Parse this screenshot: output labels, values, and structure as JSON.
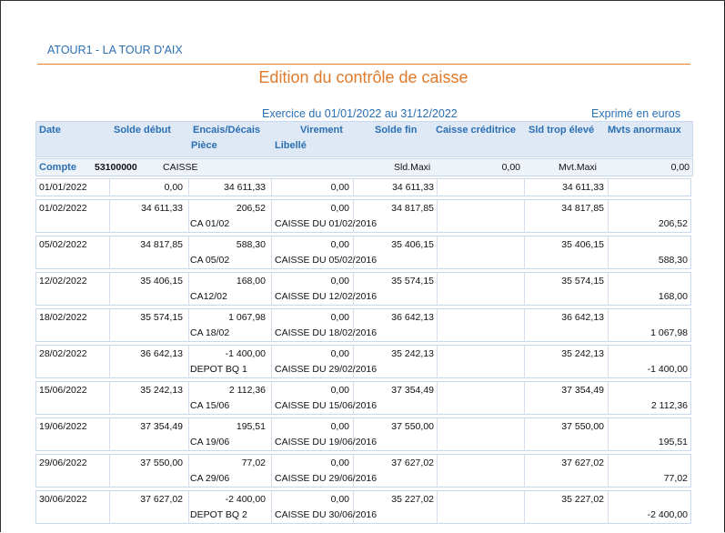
{
  "header": {
    "company": "ATOUR1 - LA TOUR D'AIX",
    "title": "Edition du contrôle de caisse",
    "period": "Exercice du 01/01/2022 au 31/12/2022",
    "unit": "Exprimé en euros"
  },
  "columns": {
    "date": "Date",
    "solde_debut": "Solde début",
    "encais_decais": "Encais/Décais",
    "piece": "Pièce",
    "virement": "Virement",
    "libelle": "Libellé",
    "solde_fin": "Solde fin",
    "caisse_creditrice": "Caisse créditrice",
    "sld_trop_eleve": "Sld trop élevé",
    "mvts_anormaux": "Mvts anormaux"
  },
  "account": {
    "label": "Compte",
    "number": "53100000",
    "name": "CAISSE",
    "sld_maxi_label": "Sld.Maxi",
    "sld_maxi_value": "0,00",
    "mvt_maxi_label": "Mvt.Maxi",
    "mvt_maxi_value": "0,00"
  },
  "rows": [
    {
      "date": "01/01/2022",
      "solde_debut": "0,00",
      "encais": "34 611,33",
      "virement": "0,00",
      "solde_fin": "34 611,33",
      "sld_trop": "34 611,33",
      "piece": "",
      "libelle": "",
      "mvts": ""
    },
    {
      "date": "01/02/2022",
      "solde_debut": "34 611,33",
      "encais": "206,52",
      "virement": "0,00",
      "solde_fin": "34 817,85",
      "sld_trop": "34 817,85",
      "piece": "CA 01/02",
      "libelle": "CAISSE DU 01/02/2016",
      "mvts": "206,52"
    },
    {
      "date": "05/02/2022",
      "solde_debut": "34 817,85",
      "encais": "588,30",
      "virement": "0,00",
      "solde_fin": "35 406,15",
      "sld_trop": "35 406,15",
      "piece": "CA 05/02",
      "libelle": "CAISSE DU  05/02/2016",
      "mvts": "588,30"
    },
    {
      "date": "12/02/2022",
      "solde_debut": "35 406,15",
      "encais": "168,00",
      "virement": "0,00",
      "solde_fin": "35 574,15",
      "sld_trop": "35 574,15",
      "piece": "CA12/02",
      "libelle": "CAISSE DU  12/02/2016",
      "mvts": "168,00"
    },
    {
      "date": "18/02/2022",
      "solde_debut": "35 574,15",
      "encais": "1 067,98",
      "virement": "0,00",
      "solde_fin": "36 642,13",
      "sld_trop": "36 642,13",
      "piece": "CA 18/02",
      "libelle": "CAISSE DU  18/02/2016",
      "mvts": "1 067,98"
    },
    {
      "date": "28/02/2022",
      "solde_debut": "36 642,13",
      "encais": "-1 400,00",
      "virement": "0,00",
      "solde_fin": "35 242,13",
      "sld_trop": "35 242,13",
      "piece": "DEPOT BQ 1",
      "libelle": "CAISSE DU  29/02/2016",
      "mvts": "-1 400,00"
    },
    {
      "date": "15/06/2022",
      "solde_debut": "35 242,13",
      "encais": "2 112,36",
      "virement": "0,00",
      "solde_fin": "37 354,49",
      "sld_trop": "37 354,49",
      "piece": "CA 15/06",
      "libelle": "CAISSE DU  15/06/2016",
      "mvts": "2 112,36"
    },
    {
      "date": "19/06/2022",
      "solde_debut": "37 354,49",
      "encais": "195,51",
      "virement": "0,00",
      "solde_fin": "37 550,00",
      "sld_trop": "37 550,00",
      "piece": "CA 19/06",
      "libelle": "CAISSE DU  19/06/2016",
      "mvts": "195,51"
    },
    {
      "date": "29/06/2022",
      "solde_debut": "37 550,00",
      "encais": "77,02",
      "virement": "0,00",
      "solde_fin": "37 627,02",
      "sld_trop": "37 627,02",
      "piece": "CA 29/06",
      "libelle": "CAISSE DU  29/06/2016",
      "mvts": "77,02"
    },
    {
      "date": "30/06/2022",
      "solde_debut": "37 627,02",
      "encais": "-2 400,00",
      "virement": "0,00",
      "solde_fin": "35 227,02",
      "sld_trop": "35 227,02",
      "piece": "DEPOT BQ 2",
      "libelle": "CAISSE DU  30/06/2016",
      "mvts": "-2 400,00"
    }
  ]
}
